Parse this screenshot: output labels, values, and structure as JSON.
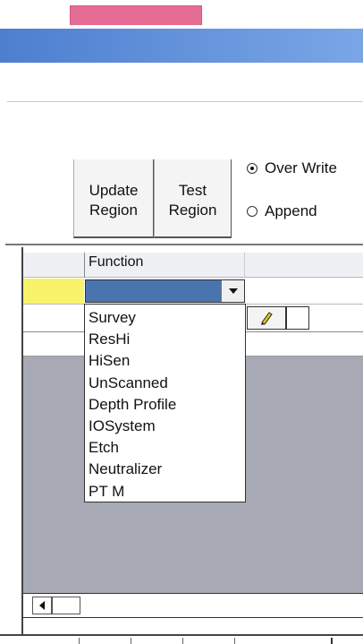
{
  "pink_tab": {
    "label": ""
  },
  "region_buttons": {
    "update": "Update\nRegion",
    "test": "Test\nRegion"
  },
  "mode_options": [
    {
      "label": "Over Write",
      "selected": true
    },
    {
      "label": "Append",
      "selected": false
    }
  ],
  "grid": {
    "column_header": "Function",
    "combo_value": ""
  },
  "function_options": [
    "Survey",
    "ResHi",
    "HiSen",
    "UnScanned",
    "Depth Profile",
    "IOSystem",
    "Etch",
    "Neutralizer",
    "PT M"
  ],
  "colors": {
    "title_bar": "#4d7fd0",
    "pink_tab": "#e56d93",
    "selected_row": "#f7f36a",
    "combo_fill": "#4a74ad",
    "grid_background": "#a7a9b4"
  },
  "icons": {
    "combo_arrow": "chevron-down-icon",
    "pencil": "pencil-icon",
    "scroll_left": "arrow-left-icon"
  }
}
